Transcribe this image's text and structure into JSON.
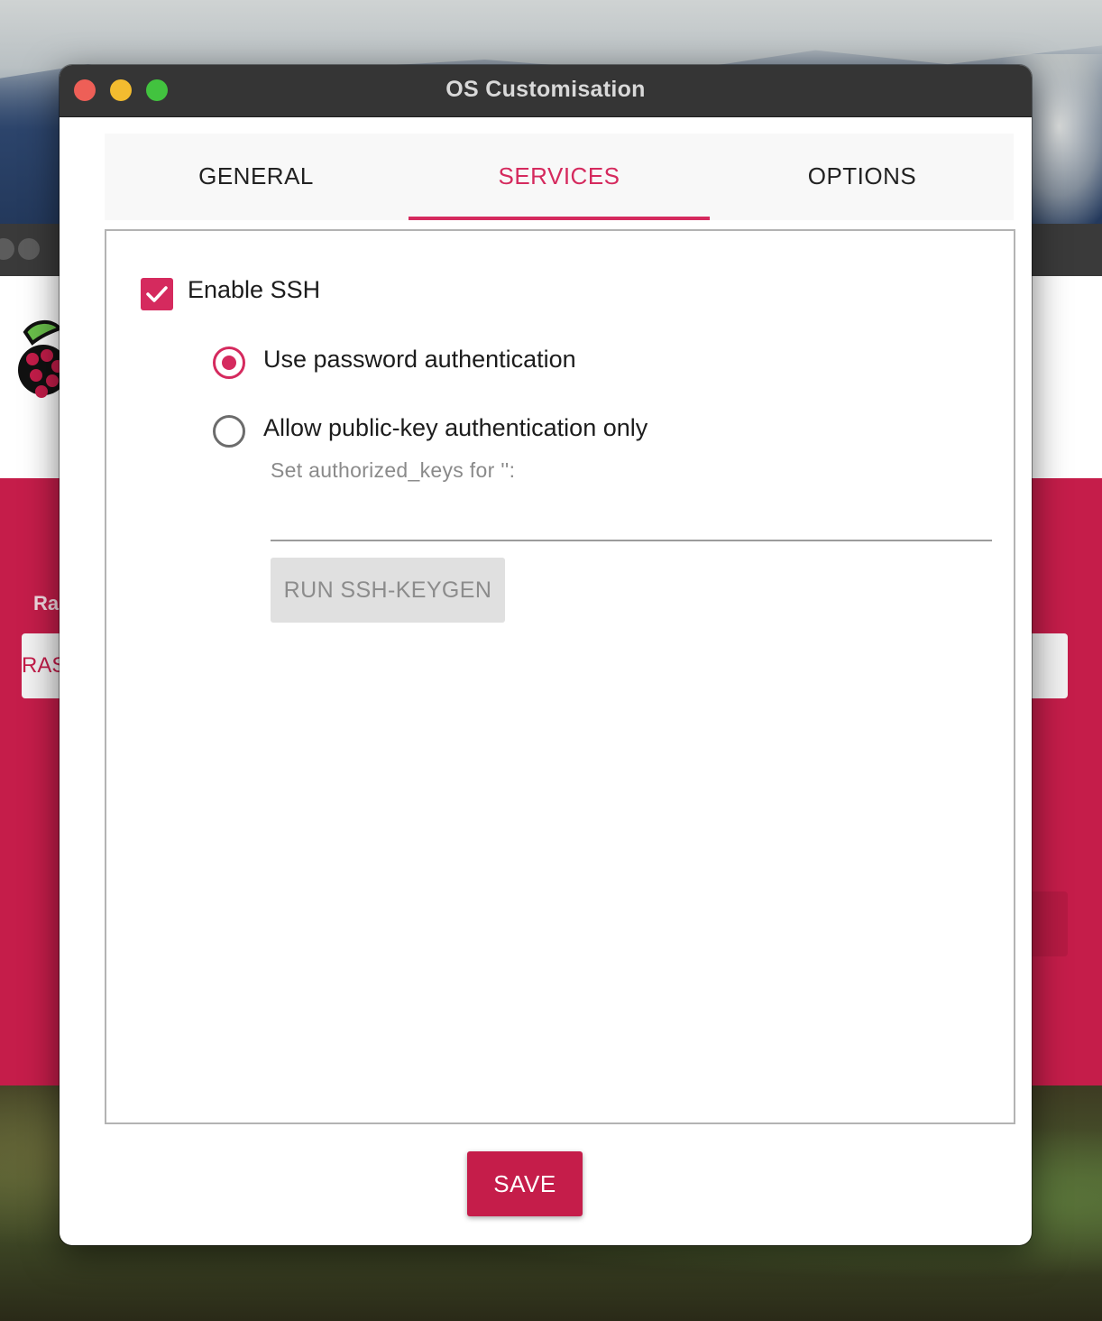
{
  "window": {
    "title": "OS Customisation"
  },
  "tabs": [
    {
      "label": "GENERAL",
      "active": false
    },
    {
      "label": "SERVICES",
      "active": true
    },
    {
      "label": "OPTIONS",
      "active": false
    }
  ],
  "services": {
    "enable_ssh": {
      "label": "Enable SSH",
      "checked": true
    },
    "auth_options": [
      {
        "label": "Use password authentication",
        "selected": true
      },
      {
        "label": "Allow public-key authentication only",
        "selected": false
      }
    ],
    "authorized_keys": {
      "label": "Set authorized_keys for '':",
      "value": ""
    },
    "keygen_button": {
      "label": "RUN SSH-KEYGEN",
      "enabled": false
    }
  },
  "footer": {
    "save_label": "SAVE"
  },
  "background_window": {
    "label_fragment": "Ra",
    "button_fragment": "RAS"
  },
  "colors": {
    "accent": "#d52a5e",
    "brand_red": "#c51d4a",
    "titlebar": "#353535"
  }
}
